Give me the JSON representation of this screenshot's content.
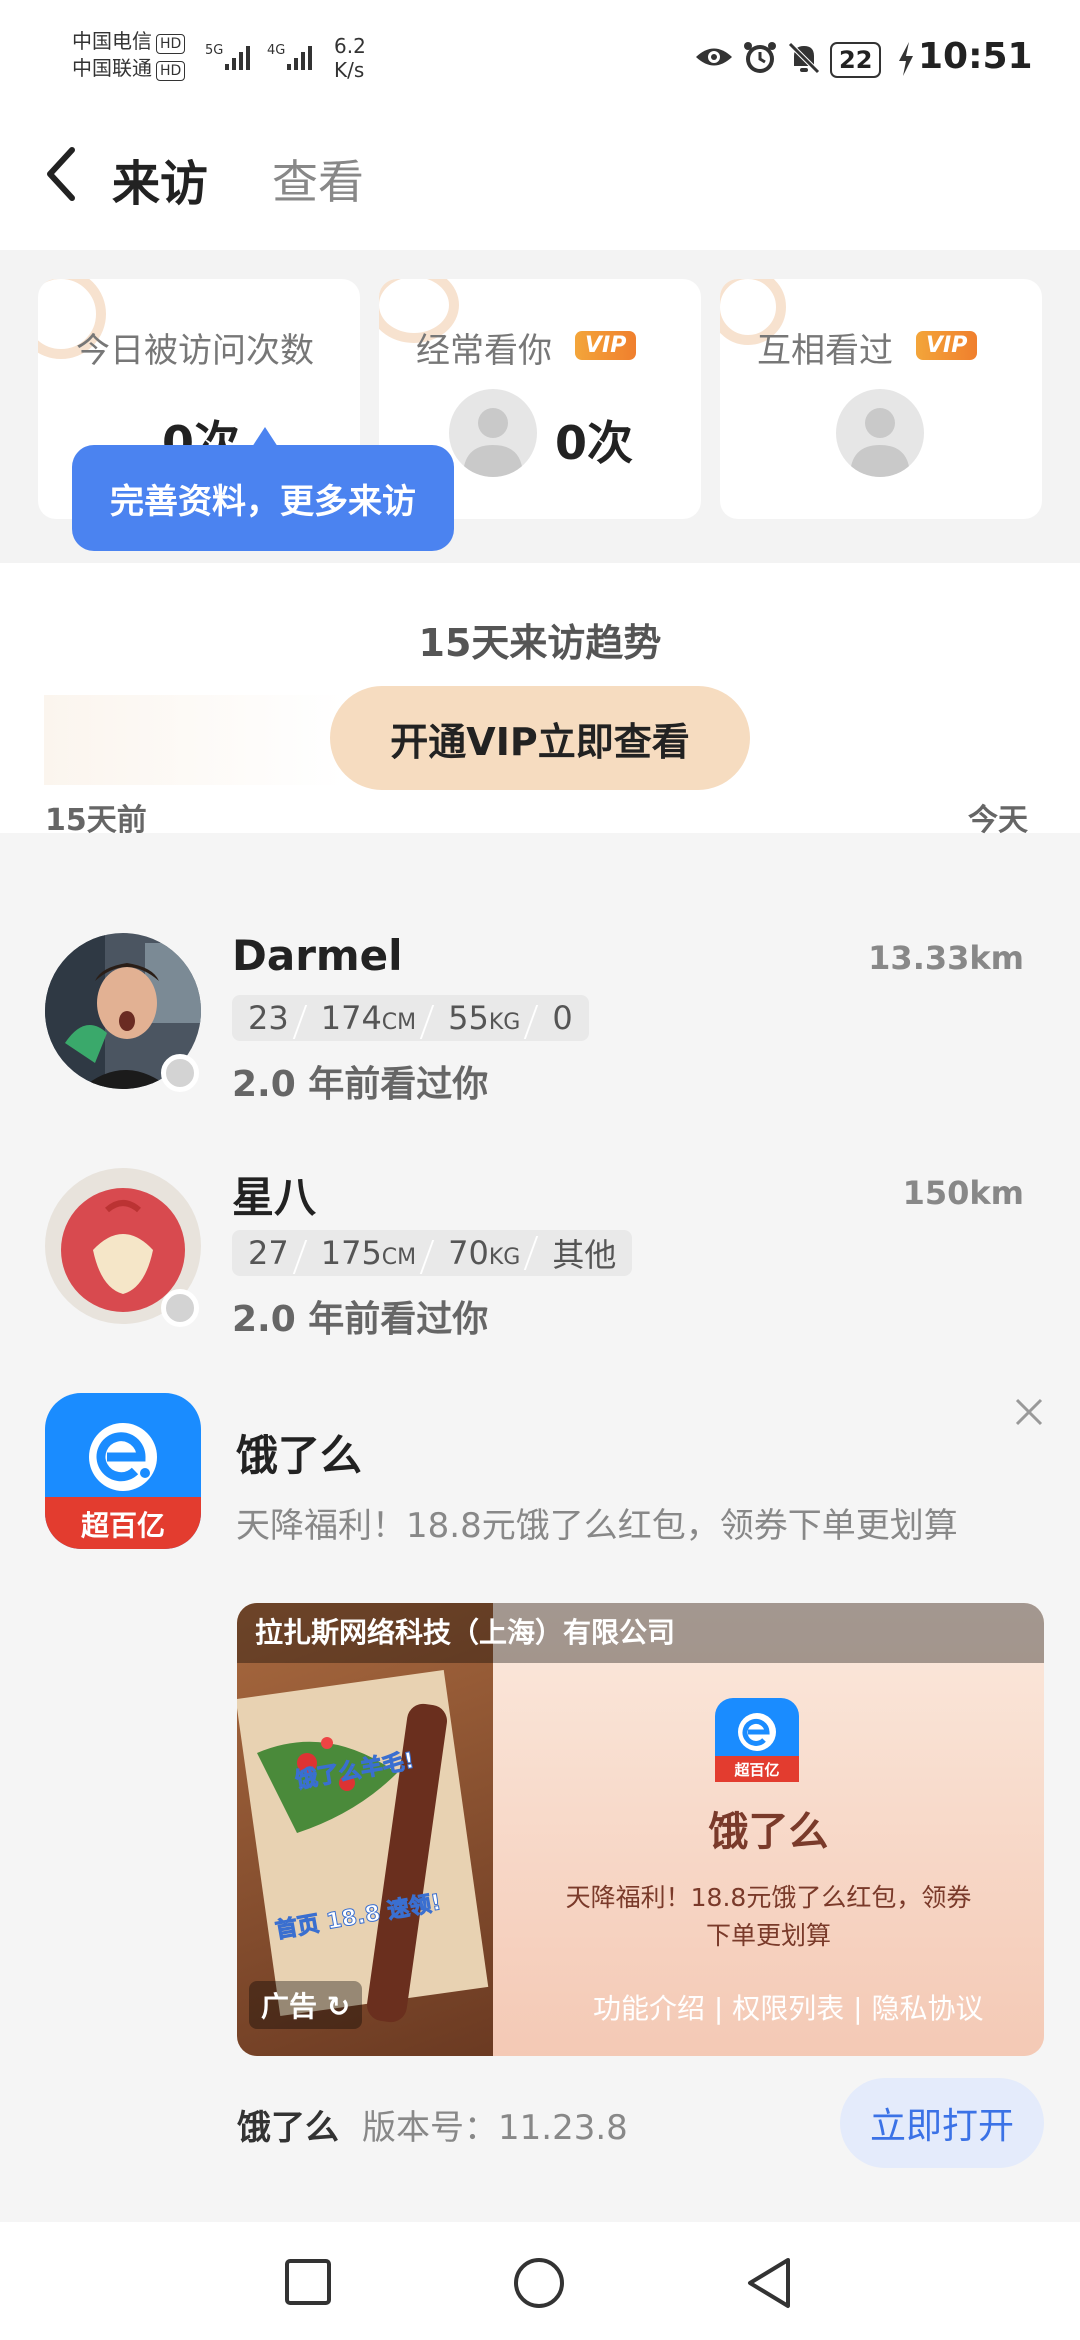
{
  "status_bar": {
    "carrier1": "中国电信",
    "carrier2": "中国联通",
    "hd": "HD",
    "net1": "5G",
    "net2": "4G",
    "speed_value": "6.2",
    "speed_unit": "K/s",
    "battery": "22",
    "time": "10:51"
  },
  "header": {
    "title": "来访",
    "subtitle": "查看"
  },
  "cards": [
    {
      "label": "今日被访问次数",
      "count": "0次"
    },
    {
      "label": "经常看你",
      "badge": "VIP",
      "count": "0次"
    },
    {
      "label": "互相看过",
      "badge": "VIP"
    }
  ],
  "tooltip": "完善资料，更多来访",
  "trend": {
    "title": "15天来访趋势",
    "vip_button": "开通VIP立即查看",
    "start_label": "15天前",
    "end_label": "今天"
  },
  "visitors": [
    {
      "name": "Darmel",
      "distance": "13.33km",
      "age": "23",
      "height": "174",
      "height_unit": "CM",
      "weight": "55",
      "weight_unit": "KG",
      "role": "0",
      "seen": "2.0 年前看过你"
    },
    {
      "name": "星八",
      "distance": "150km",
      "age": "27",
      "height": "175",
      "height_unit": "CM",
      "weight": "70",
      "weight_unit": "KG",
      "role": "其他",
      "seen": "2.0 年前看过你"
    }
  ],
  "ad": {
    "logo_badge": "超百亿",
    "title": "饿了么",
    "desc": "天降福利！18.8元饿了么红包，领券下单更划算",
    "company": "拉扎斯网络科技（上海）有限公司",
    "media_title": "饿了么",
    "media_desc_line1": "天降福利！18.8元饿了么红包，领券",
    "media_desc_line2": "下单更划算",
    "ad_label": "广告",
    "links": [
      "功能介绍",
      "权限列表",
      "隐私协议"
    ],
    "food_text1": "饿了么羊毛!",
    "food_text2": "首页 18.8 速领!",
    "footer_name": "饿了么",
    "footer_version": "版本号：11.23.8",
    "open_button": "立即打开"
  }
}
